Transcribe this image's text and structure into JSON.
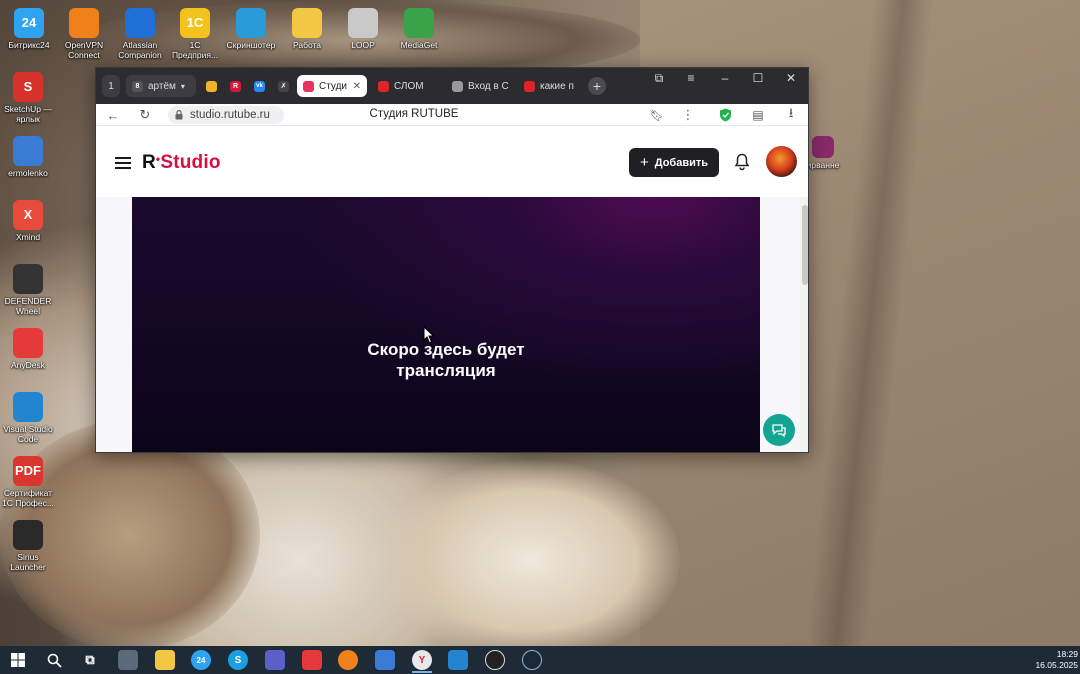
{
  "desktop": {
    "icons_top": [
      {
        "label": "Битрикс24",
        "badge": "24",
        "color": "#2ea3f2"
      },
      {
        "label": "OpenVPN Connect",
        "badge": "",
        "color": "#f0811a"
      },
      {
        "label": "Atlassian Companion",
        "badge": "",
        "color": "#1f6fd6"
      },
      {
        "label": "1С Предприя...",
        "badge": "1С",
        "color": "#f4c21d"
      },
      {
        "label": "Скриншотер",
        "badge": "",
        "color": "#2a9ad8"
      },
      {
        "label": "Работа",
        "badge": "",
        "color": "#f2c744"
      },
      {
        "label": "LOOP",
        "badge": "",
        "color": "#c9c9c9"
      },
      {
        "label": "MediaGet",
        "badge": "",
        "color": "#3aa34a"
      }
    ],
    "icons_left": [
      {
        "label": "SketchUp — ярлык",
        "badge": "S",
        "color": "#d6322b"
      },
      {
        "label": "ermolenko",
        "badge": "",
        "color": "#3a7bd5"
      },
      {
        "label": "Xmind",
        "badge": "X",
        "color": "#e84a3c"
      },
      {
        "label": "DEFENDER Wheel",
        "badge": "",
        "color": "#333333"
      },
      {
        "label": "AnyDesk",
        "badge": "",
        "color": "#e63a3a"
      },
      {
        "label": "Visual Studio Code",
        "badge": "",
        "color": "#2384d0"
      },
      {
        "label": "Сертификат 1С Профес...",
        "badge": "PDF",
        "color": "#d9362f"
      },
      {
        "label": "Sirius Launcher",
        "badge": "",
        "color": "#2a2a2a"
      }
    ],
    "right_icon": {
      "label": "ирванне",
      "color": "#8a2a6b"
    }
  },
  "browser": {
    "tabs": [
      {
        "label": "1",
        "kind": "counter"
      },
      {
        "label": "артём",
        "badge": "8",
        "kind": "profile"
      },
      {
        "label": "",
        "kind": "icon",
        "color": "#f3b12a"
      },
      {
        "label": "",
        "kind": "icon",
        "color": "#d7163b",
        "glyph": "R"
      },
      {
        "label": "",
        "kind": "icon",
        "color": "#2787f5",
        "glyph": "vk"
      },
      {
        "label": "",
        "kind": "icon",
        "color": "#444444",
        "glyph": "✗"
      },
      {
        "label": "Студи",
        "kind": "active",
        "color": "#e8335f"
      },
      {
        "label": "СЛОМ",
        "kind": "normal",
        "color": "#e0232b"
      },
      {
        "label": "Вход в С",
        "kind": "normal",
        "color": "#9a9a9a"
      },
      {
        "label": "какие п",
        "kind": "normal",
        "color": "#e0232b"
      }
    ],
    "url": "studio.rutube.ru",
    "page_title": "Студия RUTUBE"
  },
  "site": {
    "logo_r": "R",
    "logo_text": "Studio",
    "add_label": "Добавить",
    "player_message": "Скоро здесь будет трансляция",
    "accent": "#d60f3f"
  },
  "taskbar": {
    "time": "18:29",
    "date": "16.05.2025"
  }
}
